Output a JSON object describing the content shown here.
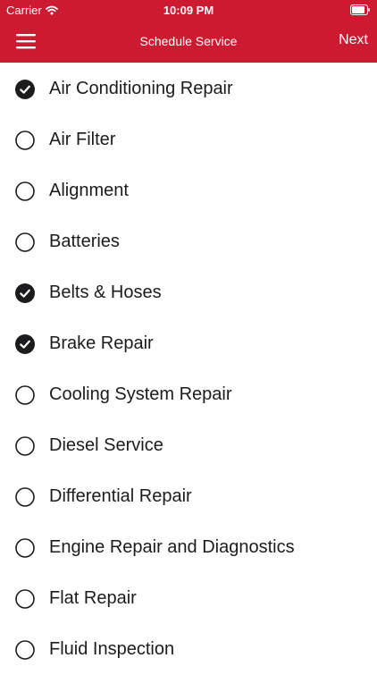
{
  "status_bar": {
    "carrier": "Carrier",
    "time": "10:09 PM",
    "icons": [
      "wifi-icon",
      "battery-icon"
    ]
  },
  "nav": {
    "title": "Schedule Service",
    "next_label": "Next",
    "menu_icon": "hamburger-menu-icon"
  },
  "colors": {
    "brand_red": "#cc1a30",
    "text": "#1c1c1e",
    "check_fill": "#1c1c1e"
  },
  "services": [
    {
      "label": "Air Conditioning Repair",
      "checked": true
    },
    {
      "label": "Air Filter",
      "checked": false
    },
    {
      "label": "Alignment",
      "checked": false
    },
    {
      "label": "Batteries",
      "checked": false
    },
    {
      "label": "Belts & Hoses",
      "checked": true
    },
    {
      "label": "Brake Repair",
      "checked": true
    },
    {
      "label": "Cooling System Repair",
      "checked": false
    },
    {
      "label": "Diesel Service",
      "checked": false
    },
    {
      "label": "Differential Repair",
      "checked": false
    },
    {
      "label": "Engine Repair and Diagnostics",
      "checked": false
    },
    {
      "label": "Flat Repair",
      "checked": false
    },
    {
      "label": "Fluid Inspection",
      "checked": false
    }
  ]
}
